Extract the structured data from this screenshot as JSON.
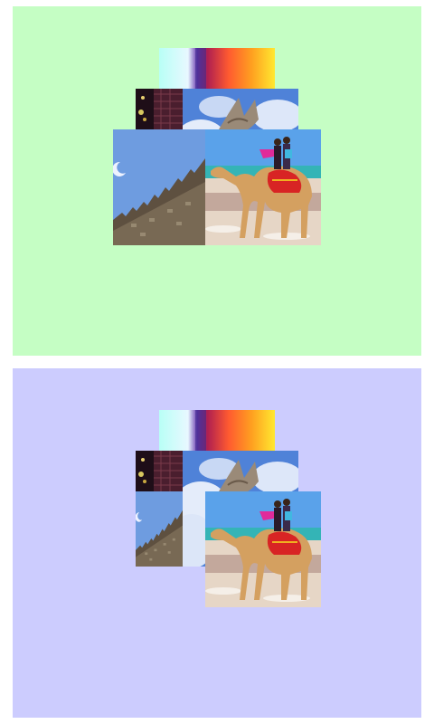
{
  "panels": [
    {
      "id": "top",
      "background": "#c5fec4"
    },
    {
      "id": "bottom",
      "background": "#ccccfe"
    }
  ],
  "tiles": [
    {
      "name": "gradient-image",
      "colors": [
        "#a8fff0",
        "#7a2a9a",
        "#ff6a3a",
        "#ffe830"
      ]
    },
    {
      "name": "dark-image",
      "colors": [
        "#1c0c18",
        "#5c2c3a",
        "#d8c860"
      ]
    },
    {
      "name": "sky-image",
      "colors": [
        "#4a7ad0",
        "#d8e4f8",
        "#8a7a6a"
      ]
    },
    {
      "name": "castle-image",
      "colors": [
        "#6a9adc",
        "#5a4e3e",
        "#b0a28a"
      ]
    },
    {
      "name": "camel-image",
      "colors": [
        "#5aa0e8",
        "#3ab8b8",
        "#e8d8c8",
        "#c89050",
        "#d82020"
      ]
    }
  ]
}
